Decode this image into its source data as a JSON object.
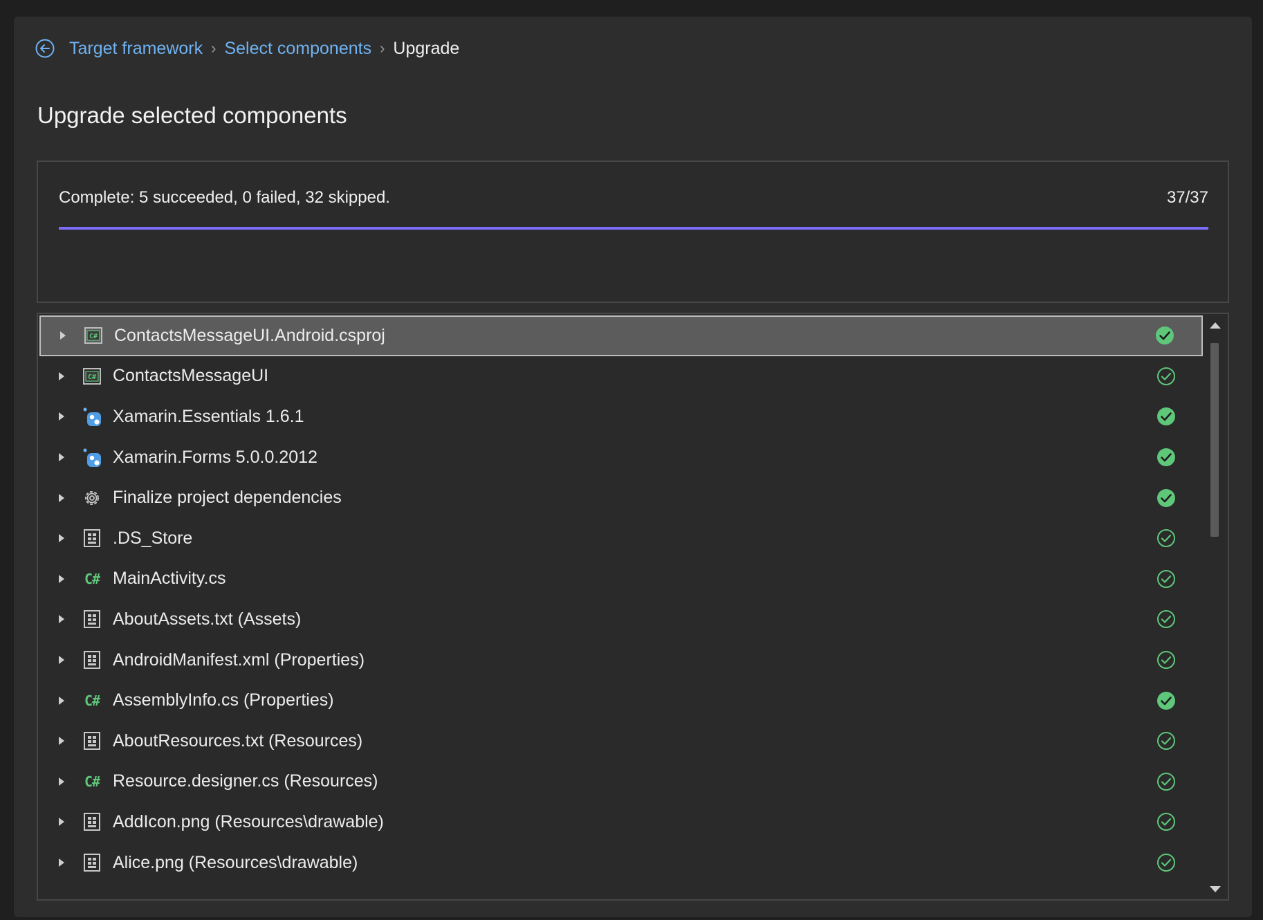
{
  "breadcrumb": {
    "items": [
      "Target framework",
      "Select components"
    ],
    "current": "Upgrade",
    "separator": "›"
  },
  "page": {
    "title": "Upgrade selected components"
  },
  "status": {
    "message": "Complete: 5 succeeded, 0 failed, 32 skipped.",
    "count": "37/37",
    "progress_fraction": 1.0,
    "progress_color": "#7b6cf6"
  },
  "components": {
    "items": [
      {
        "label": "ContactsMessageUI.Android.csproj",
        "icon": "csharp-project-icon",
        "status": "succeeded",
        "selected": true
      },
      {
        "label": "ContactsMessageUI",
        "icon": "csharp-project-icon",
        "status": "skipped"
      },
      {
        "label": "Xamarin.Essentials 1.6.1",
        "icon": "nuget-package-icon",
        "status": "succeeded"
      },
      {
        "label": "Xamarin.Forms 5.0.0.2012",
        "icon": "nuget-package-icon",
        "status": "succeeded"
      },
      {
        "label": "Finalize project dependencies",
        "icon": "gear-icon",
        "status": "succeeded"
      },
      {
        "label": ".DS_Store",
        "icon": "file-icon",
        "status": "skipped"
      },
      {
        "label": "MainActivity.cs",
        "icon": "csharp-file-icon",
        "status": "skipped"
      },
      {
        "label": "AboutAssets.txt (Assets)",
        "icon": "file-icon",
        "status": "skipped"
      },
      {
        "label": "AndroidManifest.xml (Properties)",
        "icon": "file-icon",
        "status": "skipped"
      },
      {
        "label": "AssemblyInfo.cs (Properties)",
        "icon": "csharp-file-icon",
        "status": "succeeded"
      },
      {
        "label": "AboutResources.txt (Resources)",
        "icon": "file-icon",
        "status": "skipped"
      },
      {
        "label": "Resource.designer.cs (Resources)",
        "icon": "csharp-file-icon",
        "status": "skipped"
      },
      {
        "label": "AddIcon.png (Resources\\drawable)",
        "icon": "file-icon",
        "status": "skipped"
      },
      {
        "label": "Alice.png (Resources\\drawable)",
        "icon": "file-icon",
        "status": "skipped"
      }
    ],
    "csharp_glyph": "C#"
  },
  "colors": {
    "link": "#6fb2f2",
    "success": "#5fc77a",
    "background": "#2d2d2d"
  }
}
